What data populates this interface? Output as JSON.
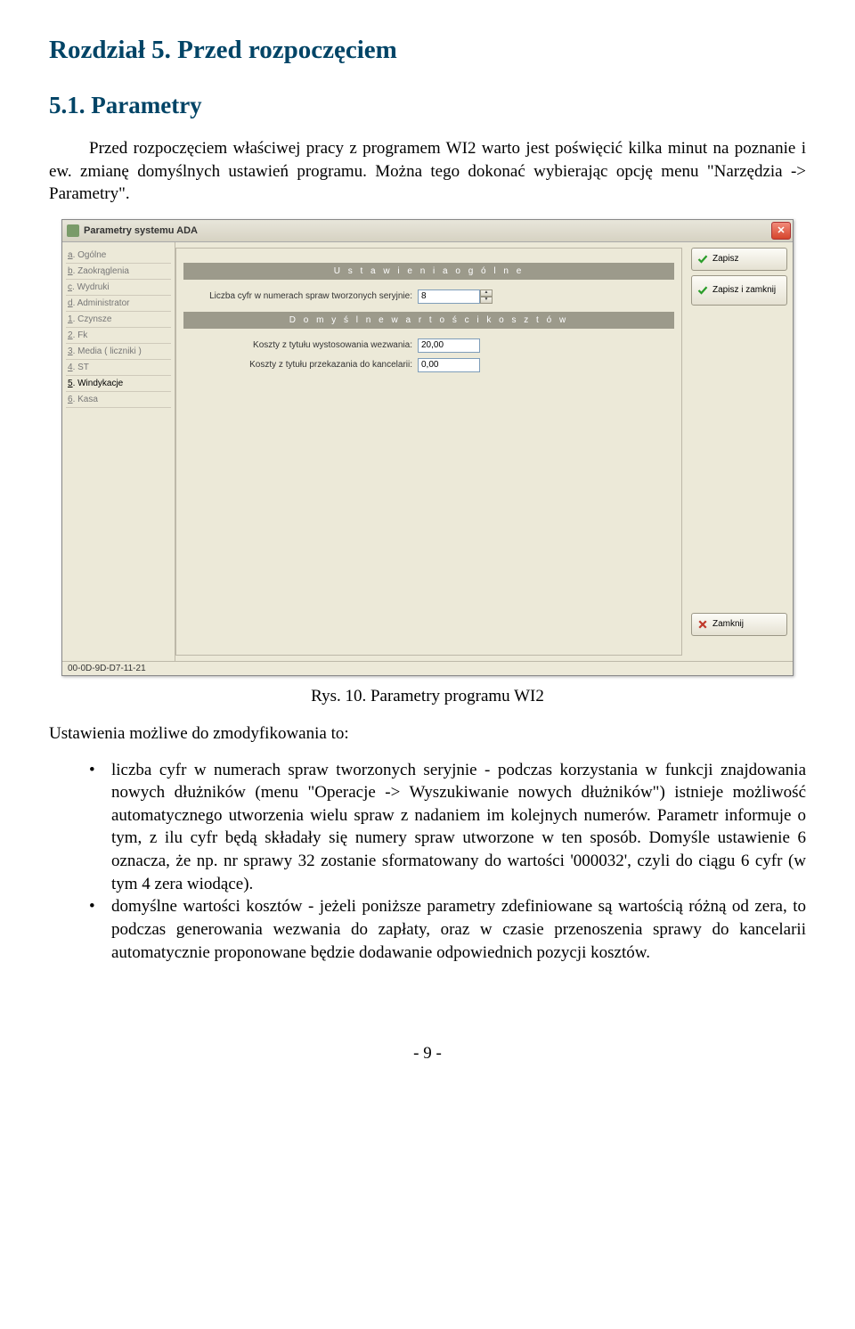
{
  "doc": {
    "chapter_title": "Rozdział 5. Przed rozpoczęciem",
    "section_title": "5.1. Parametry",
    "para1": "Przed rozpoczęciem właściwej pracy z programem WI2 warto jest poświęcić kilka minut na poznanie i ew. zmianę domyślnych ustawień programu. Można tego dokonać wybierając opcję menu \"Narzędzia -> Parametry\".",
    "caption": "Rys. 10. Parametry programu WI2",
    "para2": "Ustawienia możliwe do zmodyfikowania to:",
    "bullet1": "liczba cyfr w numerach spraw tworzonych seryjnie - podczas korzystania w funkcji znajdowania nowych dłużników (menu \"Operacje -> Wyszukiwanie nowych dłużników\") istnieje możliwość automatycznego utworzenia wielu spraw z nadaniem im kolejnych numerów. Parametr informuje o tym, z ilu cyfr będą składały się numery spraw utworzone w ten sposób. Domyśle ustawienie 6 oznacza, że np. nr sprawy 32 zostanie sformatowany do wartości '000032', czyli do ciągu 6 cyfr (w tym 4 zera wiodące).",
    "bullet2": "domyślne wartości kosztów - jeżeli poniższe parametry zdefiniowane są wartością różną od zera, to podczas generowania wezwania do zapłaty, oraz w czasie przenoszenia sprawy do kancelarii automatycznie proponowane będzie dodawanie odpowiednich pozycji kosztów.",
    "page_num": "- 9 -"
  },
  "window": {
    "title": "Parametry systemu ADA",
    "sidebar": [
      {
        "prefix": "a",
        "label": ". Ogólne"
      },
      {
        "prefix": "b",
        "label": ". Zaokrąglenia"
      },
      {
        "prefix": "c",
        "label": ". Wydruki"
      },
      {
        "prefix": "d",
        "label": ". Administrator"
      },
      {
        "prefix": "1",
        "label": ". Czynsze"
      },
      {
        "prefix": "2",
        "label": ". Fk"
      },
      {
        "prefix": "3",
        "label": ". Media ( liczniki )"
      },
      {
        "prefix": "4",
        "label": ". ST"
      },
      {
        "prefix": "5",
        "label": ". Windykacje"
      },
      {
        "prefix": "6",
        "label": ". Kasa"
      }
    ],
    "section1": "U s t a w i e n i a   o g ó l n e",
    "field1_label": "Liczba cyfr w numerach spraw tworzonych seryjnie:",
    "field1_value": "8",
    "section2": "D o m y ś l n e   w a r t o ś c i   k o s z t ó w",
    "field2_label": "Koszty z tytułu wystosowania wezwania:",
    "field2_value": "20,00",
    "field3_label": "Koszty z tytułu przekazania do kancelarii:",
    "field3_value": "0,00",
    "btn_zapisz": "Zapisz",
    "btn_zapisz_zamknij": "Zapisz i zamknij",
    "btn_zamknij": "Zamknij",
    "status": "00-0D-9D-D7-11-21"
  }
}
